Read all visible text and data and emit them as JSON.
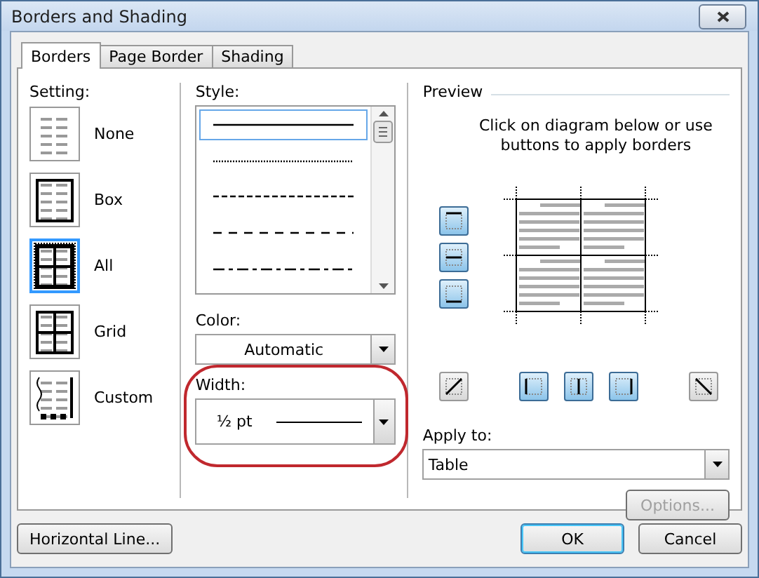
{
  "window": {
    "title": "Borders and Shading"
  },
  "tabs": [
    {
      "label": "Borders",
      "selected": true
    },
    {
      "label": "Page Border",
      "selected": false
    },
    {
      "label": "Shading",
      "selected": false
    }
  ],
  "setting": {
    "label": "Setting:",
    "items": [
      {
        "label": "None",
        "kind": "none",
        "selected": false
      },
      {
        "label": "Box",
        "kind": "box",
        "selected": false
      },
      {
        "label": "All",
        "kind": "all",
        "selected": true
      },
      {
        "label": "Grid",
        "kind": "grid",
        "selected": false
      },
      {
        "label": "Custom",
        "kind": "custom",
        "selected": false
      }
    ]
  },
  "style": {
    "label": "Style:",
    "options": [
      {
        "kind": "solid",
        "selected": true
      },
      {
        "kind": "dotted",
        "selected": false
      },
      {
        "kind": "dashed",
        "selected": false
      },
      {
        "kind": "long-dash",
        "selected": false
      },
      {
        "kind": "dash-dot",
        "selected": false
      }
    ]
  },
  "color": {
    "label": "Color:",
    "value": "Automatic"
  },
  "width": {
    "label": "Width:",
    "value": "½ pt",
    "highlighted": true
  },
  "preview": {
    "title": "Preview",
    "hint": "Click on diagram below or use buttons to apply borders",
    "side_buttons": [
      {
        "kind": "top",
        "on": true
      },
      {
        "kind": "inside-horizontal",
        "on": true
      },
      {
        "kind": "bottom",
        "on": true
      }
    ],
    "bottom_buttons": [
      {
        "kind": "diagonal-up",
        "on": false
      },
      {
        "kind": "left",
        "on": true
      },
      {
        "kind": "inside-vertical",
        "on": true
      },
      {
        "kind": "right",
        "on": true
      },
      {
        "kind": "diagonal-down",
        "on": false
      }
    ]
  },
  "apply_to": {
    "label": "Apply to:",
    "value": "Table"
  },
  "options_button": {
    "label": "Options...",
    "disabled": true
  },
  "buttons": [
    {
      "label": "Horizontal Line...",
      "kind": "left",
      "default": false
    },
    {
      "label": "OK",
      "kind": "right",
      "default": true
    },
    {
      "label": "Cancel",
      "kind": "right",
      "default": false
    }
  ]
}
